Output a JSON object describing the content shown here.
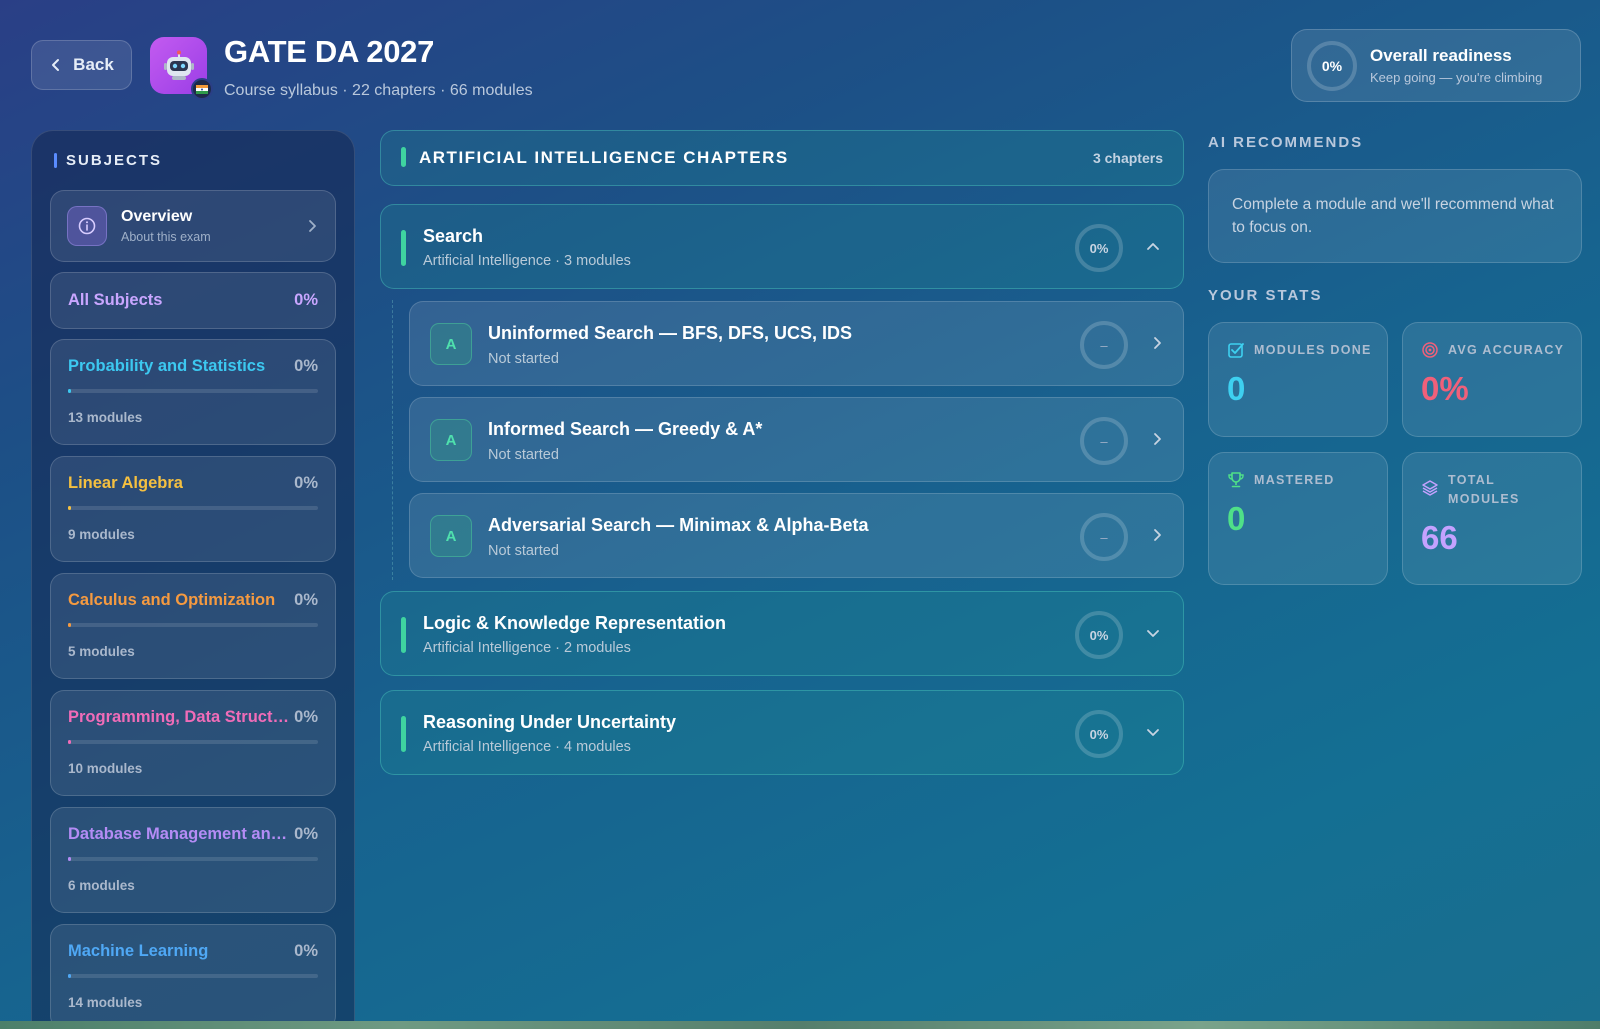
{
  "header": {
    "back_label": "Back",
    "title": "GATE DA 2027",
    "subtitle": "Course syllabus · 22 chapters · 66 modules",
    "app_icon": "robot-icon",
    "flag_icon": "india-flag-icon"
  },
  "readiness": {
    "value": "0%",
    "fraction": 0,
    "title": "Overall readiness",
    "subtitle": "Keep going — you're climbing"
  },
  "sidebar": {
    "heading": "SUBJECTS",
    "overview": {
      "title": "Overview",
      "subtitle": "About this exam"
    },
    "all_subjects": {
      "label": "All Subjects",
      "pct": "0%"
    },
    "subjects": [
      {
        "name": "Probability and Statistics",
        "pct": "0%",
        "count": "13 modules",
        "color": "#3cc8f0"
      },
      {
        "name": "Linear Algebra",
        "pct": "0%",
        "count": "9 modules",
        "color": "#f5c040"
      },
      {
        "name": "Calculus and Optimization",
        "pct": "0%",
        "count": "5 modules",
        "color": "#f59a40"
      },
      {
        "name": "Programming, Data Structures and Algorithms",
        "pct": "0%",
        "count": "10 modules",
        "color": "#f06cb8"
      },
      {
        "name": "Database Management and Warehousing",
        "pct": "0%",
        "count": "6 modules",
        "color": "#b48cf5"
      },
      {
        "name": "Machine Learning",
        "pct": "0%",
        "count": "14 modules",
        "color": "#4fa8f5"
      }
    ]
  },
  "center": {
    "section_title": "ARTIFICIAL INTELLIGENCE CHAPTERS",
    "section_count": "3 chapters",
    "chapters": [
      {
        "title": "Search",
        "subtitle": "Artificial Intelligence · 3 modules",
        "progress": "0%",
        "expanded": true
      },
      {
        "title": "Logic & Knowledge Representation",
        "subtitle": "Artificial Intelligence · 2 modules",
        "progress": "0%",
        "expanded": false
      },
      {
        "title": "Reasoning Under Uncertainty",
        "subtitle": "Artificial Intelligence · 4 modules",
        "progress": "0%",
        "expanded": false
      }
    ],
    "modules": [
      {
        "badge": "A",
        "title": "Uninformed Search — BFS, DFS, UCS, IDS",
        "status": "Not started",
        "score": "–"
      },
      {
        "badge": "A",
        "title": "Informed Search — Greedy & A*",
        "status": "Not started",
        "score": "–"
      },
      {
        "badge": "A",
        "title": "Adversarial Search — Minimax & Alpha-Beta",
        "status": "Not started",
        "score": "–"
      }
    ]
  },
  "right": {
    "ai_heading": "AI RECOMMENDS",
    "ai_text": "Complete a module and we'll recommend what to focus on.",
    "stats_heading": "YOUR STATS",
    "stats": {
      "modules_done": {
        "label": "MODULES DONE",
        "value": "0",
        "color": "#3ed0f0"
      },
      "avg_accuracy": {
        "label": "AVG ACCURACY",
        "value": "0%",
        "color": "#f0607a"
      },
      "mastered": {
        "label": "MASTERED",
        "value": "0",
        "color": "#4fe088"
      },
      "total_modules": {
        "label_line1": "TOTAL",
        "label_line2": "MODULES",
        "value": "66",
        "color": "#c4a2ff"
      }
    }
  },
  "colors": {
    "accent_green": "#3fd3a0",
    "accent_purple": "#c9a6ff"
  }
}
